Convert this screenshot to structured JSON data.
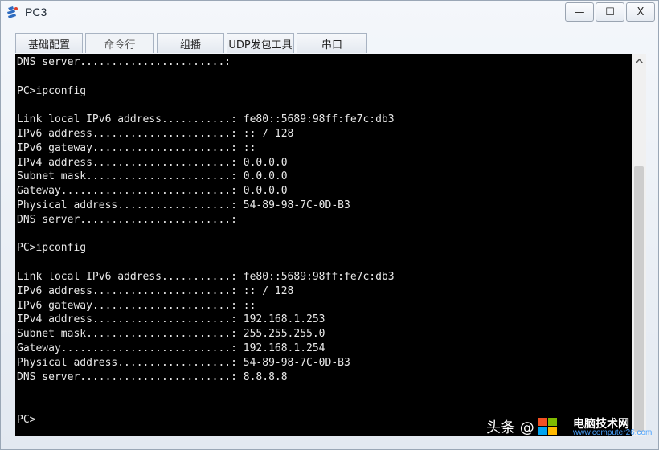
{
  "window": {
    "title": "PC3",
    "icon": "pc-app-icon",
    "minimize_label": "—",
    "maximize_label": "☐",
    "close_label": "X"
  },
  "tabs": [
    {
      "label": "基础配置",
      "active": false
    },
    {
      "label": "命令行",
      "active": true
    },
    {
      "label": "组播",
      "active": false
    },
    {
      "label": "UDP发包工具",
      "active": false
    },
    {
      "label": "串口",
      "active": false
    }
  ],
  "terminal": {
    "lines": [
      "DNS server.......................:",
      "",
      "PC>ipconfig",
      "",
      "Link local IPv6 address...........: fe80::5689:98ff:fe7c:db3",
      "IPv6 address......................: :: / 128",
      "IPv6 gateway......................: ::",
      "IPv4 address......................: 0.0.0.0",
      "Subnet mask.......................: 0.0.0.0",
      "Gateway...........................: 0.0.0.0",
      "Physical address..................: 54-89-98-7C-0D-B3",
      "DNS server........................:",
      "",
      "PC>ipconfig",
      "",
      "Link local IPv6 address...........: fe80::5689:98ff:fe7c:db3",
      "IPv6 address......................: :: / 128",
      "IPv6 gateway......................: ::",
      "IPv4 address......................: 192.168.1.253",
      "Subnet mask.......................: 255.255.255.0",
      "Gateway...........................: 192.168.1.254",
      "Physical address..................: 54-89-98-7C-0D-B3",
      "DNS server........................: 8.8.8.8",
      "",
      "",
      "PC>"
    ]
  },
  "watermark": {
    "text": "头条 @",
    "brand": "电脑技术网",
    "site": "www.computer26.com"
  },
  "colors": {
    "terminal_bg": "#000000",
    "terminal_fg": "#e8e8e8",
    "window_bg": "#e9eef4"
  }
}
